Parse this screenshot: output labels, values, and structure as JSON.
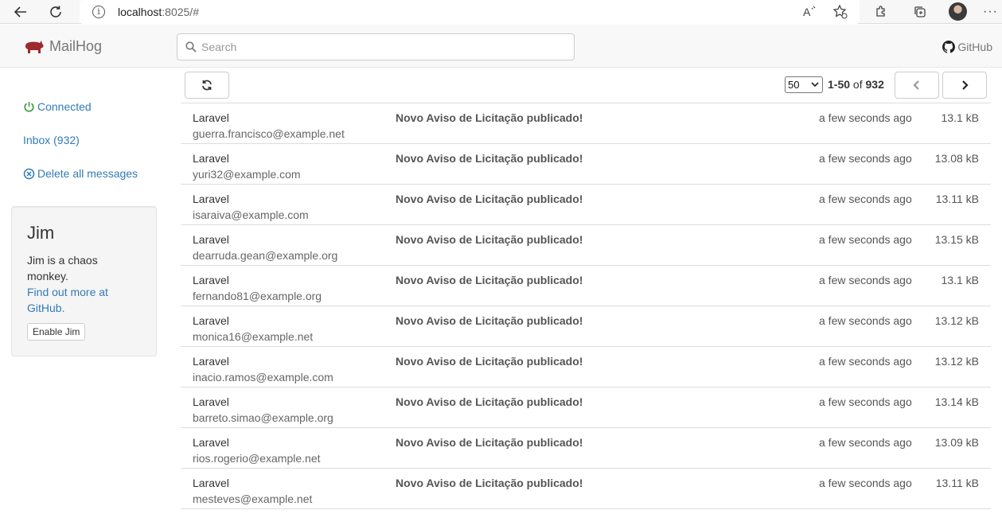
{
  "browser": {
    "url_host": "localhost",
    "url_rest": ":8025/#"
  },
  "navbar": {
    "brand": "MailHog",
    "search_placeholder": "Search",
    "github": "GitHub"
  },
  "sidebar": {
    "connected": "Connected",
    "inbox": "Inbox (932)",
    "delete_all": "Delete all messages"
  },
  "jim": {
    "title": "Jim",
    "description": "Jim is a chaos monkey.",
    "link": "Find out more at GitHub.",
    "button": "Enable Jim"
  },
  "toolbar": {
    "per_page": "50",
    "range": "1-50",
    "of": "of",
    "total": "932"
  },
  "messages": [
    {
      "from": "Laravel",
      "to": "guerra.francisco@example.net",
      "subject": "Novo Aviso de Licitação publicado!",
      "time": "a few seconds ago",
      "size": "13.1 kB"
    },
    {
      "from": "Laravel",
      "to": "yuri32@example.com",
      "subject": "Novo Aviso de Licitação publicado!",
      "time": "a few seconds ago",
      "size": "13.08 kB"
    },
    {
      "from": "Laravel",
      "to": "isaraiva@example.com",
      "subject": "Novo Aviso de Licitação publicado!",
      "time": "a few seconds ago",
      "size": "13.11 kB"
    },
    {
      "from": "Laravel",
      "to": "dearruda.gean@example.org",
      "subject": "Novo Aviso de Licitação publicado!",
      "time": "a few seconds ago",
      "size": "13.15 kB"
    },
    {
      "from": "Laravel",
      "to": "fernando81@example.org",
      "subject": "Novo Aviso de Licitação publicado!",
      "time": "a few seconds ago",
      "size": "13.1 kB"
    },
    {
      "from": "Laravel",
      "to": "monica16@example.net",
      "subject": "Novo Aviso de Licitação publicado!",
      "time": "a few seconds ago",
      "size": "13.12 kB"
    },
    {
      "from": "Laravel",
      "to": "inacio.ramos@example.com",
      "subject": "Novo Aviso de Licitação publicado!",
      "time": "a few seconds ago",
      "size": "13.12 kB"
    },
    {
      "from": "Laravel",
      "to": "barreto.simao@example.org",
      "subject": "Novo Aviso de Licitação publicado!",
      "time": "a few seconds ago",
      "size": "13.14 kB"
    },
    {
      "from": "Laravel",
      "to": "rios.rogerio@example.net",
      "subject": "Novo Aviso de Licitação publicado!",
      "time": "a few seconds ago",
      "size": "13.09 kB"
    },
    {
      "from": "Laravel",
      "to": "mesteves@example.net",
      "subject": "Novo Aviso de Licitação publicado!",
      "time": "a few seconds ago",
      "size": "13.11 kB"
    }
  ],
  "colors": {
    "link": "#337ab7",
    "connected": "#3c9a3c",
    "brand_icon": "#9e2a2b"
  }
}
